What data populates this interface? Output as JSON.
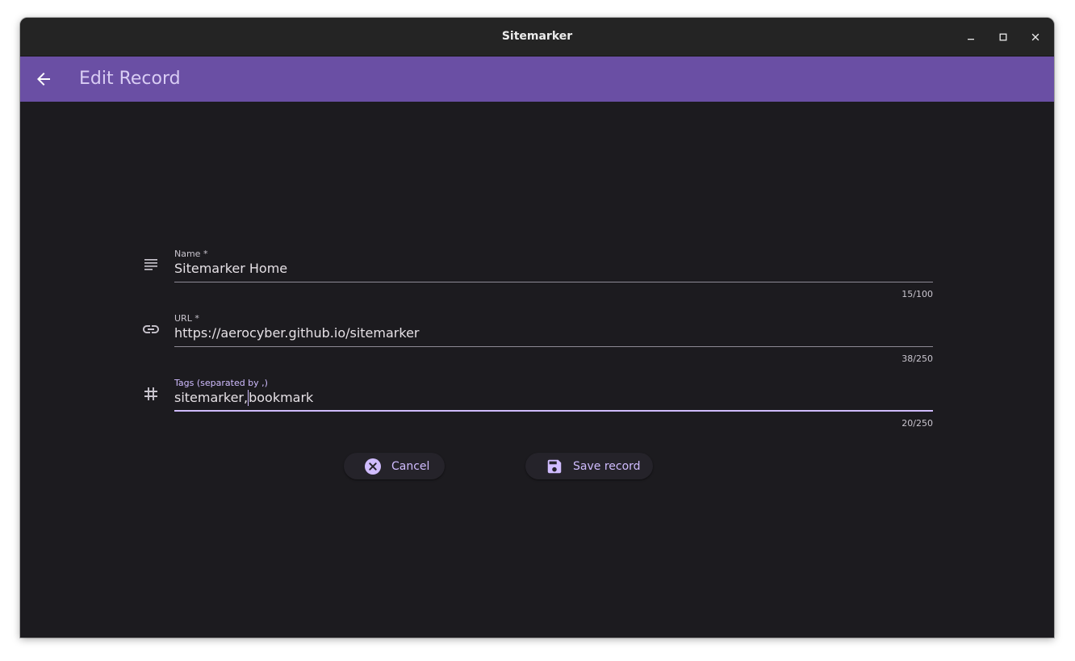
{
  "window": {
    "title": "Sitemarker",
    "controls": [
      "minimize-icon",
      "maximize-icon",
      "close-icon"
    ]
  },
  "appbar": {
    "title": "Edit Record",
    "back_icon": "arrow-back-icon",
    "color": "#6a4fa4"
  },
  "form": {
    "name": {
      "icon": "notes-icon",
      "label": "Name *",
      "value": "Sitemarker Home",
      "counter": "15/100"
    },
    "url": {
      "icon": "link-icon",
      "label": "URL *",
      "value": "https://aerocyber.github.io/sitemarker",
      "counter": "38/250"
    },
    "tags": {
      "icon": "tag-icon",
      "label": "Tags (separated by ,)",
      "value_before_caret": "sitemarker,",
      "value_after_caret": "bookmark",
      "counter": "20/250"
    }
  },
  "actions": {
    "cancel": {
      "label": "Cancel",
      "icon": "cancel-circle-icon"
    },
    "save": {
      "label": "Save record",
      "icon": "save-icon"
    }
  },
  "colors": {
    "background": "#1c1b1f",
    "accent": "#d0bcff",
    "titlebar": "#242424"
  }
}
